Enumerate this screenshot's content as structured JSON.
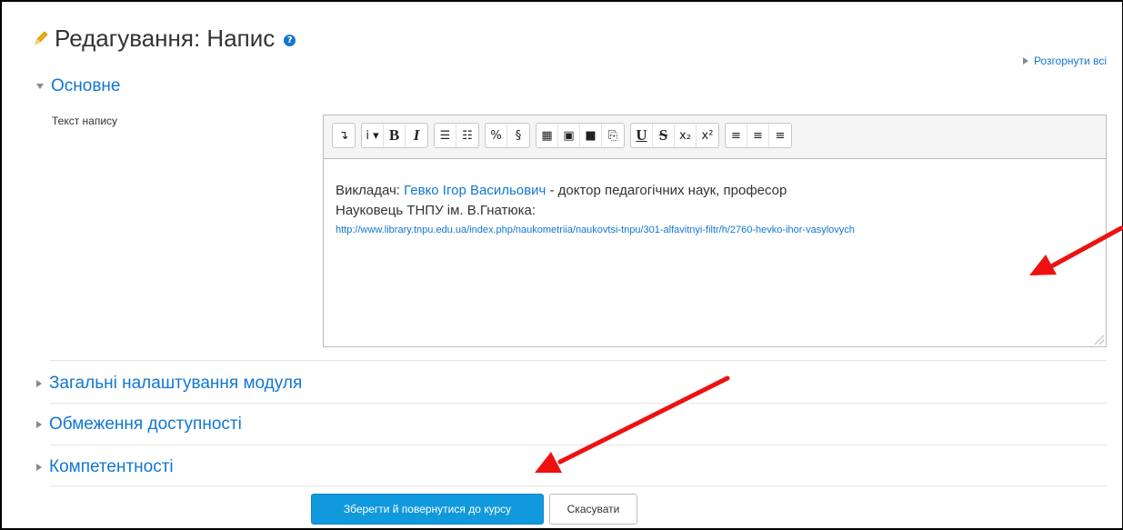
{
  "header": {
    "title": "Редагування: Напис",
    "help": "?"
  },
  "expand_all": "Розгорнути всі",
  "sections": {
    "general": "Основне",
    "module_settings": "Загальні налаштування модуля",
    "restrictions": "Обмеження доступності",
    "competencies": "Компетентності"
  },
  "form": {
    "text_label": "Текст напису"
  },
  "toolbar": {
    "group1": [
      {
        "name": "collapse-icon",
        "glyph": "↴"
      }
    ],
    "group2": [
      {
        "name": "paragraph-styles-icon",
        "glyph": "i ▾"
      },
      {
        "name": "bold-icon",
        "glyph": "B"
      },
      {
        "name": "italic-icon",
        "glyph": "I"
      }
    ],
    "group3": [
      {
        "name": "unordered-list-icon",
        "glyph": "☰"
      },
      {
        "name": "ordered-list-icon",
        "glyph": "☷"
      }
    ],
    "group4": [
      {
        "name": "link-icon",
        "glyph": "%"
      },
      {
        "name": "unlink-icon",
        "glyph": "§"
      }
    ],
    "group5": [
      {
        "name": "moodle-media-icon",
        "glyph": "▦"
      },
      {
        "name": "image-icon",
        "glyph": "▣"
      },
      {
        "name": "video-icon",
        "glyph": "■"
      },
      {
        "name": "paste-icon",
        "glyph": "⎘"
      }
    ],
    "group6": [
      {
        "name": "underline-icon",
        "glyph": "U"
      },
      {
        "name": "strikethrough-icon",
        "glyph": "S"
      },
      {
        "name": "subscript-icon",
        "glyph": "x₂"
      },
      {
        "name": "superscript-icon",
        "glyph": "x²"
      }
    ],
    "group7": [
      {
        "name": "align-left-icon",
        "glyph": "≡"
      },
      {
        "name": "align-center-icon",
        "glyph": "≡"
      },
      {
        "name": "align-right-icon",
        "glyph": "≡"
      }
    ]
  },
  "editor": {
    "line1_prefix": "Викладач:",
    "teacher_name": "Гевко Ігор Васильович",
    "line1_suffix": "-  доктор педагогічних наук, професор",
    "line2": "Науковець ТНПУ ім. В.Гнатюка:",
    "url": "http://www.library.tnpu.edu.ua/index.php/naukometriia/naukovtsi-tnpu/301-alfavitnyi-filtr/h/2760-hevko-ihor-vasylovych"
  },
  "buttons": {
    "save_return": "Зберегти й повернутися до курсу",
    "cancel": "Скасувати"
  },
  "colors": {
    "link": "#1177d1",
    "primary_button": "#1199dd",
    "annotation_arrow": "#ee1111"
  }
}
